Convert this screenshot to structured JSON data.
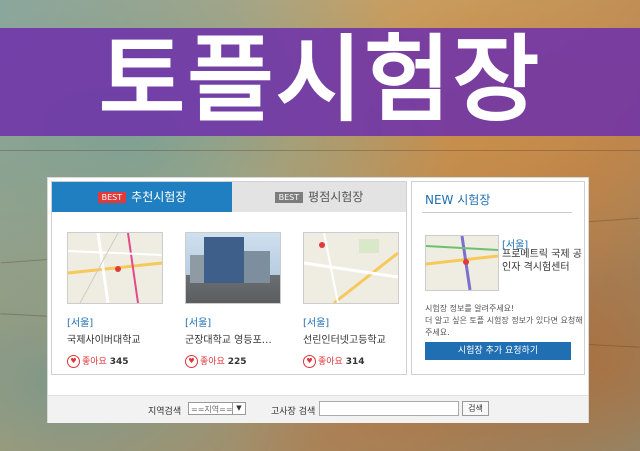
{
  "banner": {
    "title": "토플시험장"
  },
  "tabs": [
    {
      "badge": "BEST",
      "label": "추천시험장"
    },
    {
      "badge": "BEST",
      "label": "평점시험장"
    }
  ],
  "cards": [
    {
      "region": "[서울]",
      "name": "국제사이버대학교",
      "like_label": "좋아요",
      "like_count": "345"
    },
    {
      "region": "[서울]",
      "name": "군장대학교 영등포…",
      "like_label": "좋아요",
      "like_count": "225"
    },
    {
      "region": "[서울]",
      "name": "선린인터넷고등학교",
      "like_label": "좋아요",
      "like_count": "314"
    }
  ],
  "new_center": {
    "title": "NEW 시험장",
    "region": "[서울]",
    "name": "프로메트릭 국제 공인자 격시험센터",
    "desc_line1": "시험장 정보를 알려주세요!",
    "desc_line2": "더 알고 싶은 토플 시험장 정보가 있다면 요청해주세요.",
    "button": "시험장 추가 요청하기"
  },
  "search": {
    "region_label": "지역검색",
    "region_value": "==지역==",
    "center_label": "고사장 검색",
    "center_placeholder": "",
    "button": "검색"
  },
  "colors": {
    "banner": "#6e32aa",
    "accent": "#1f7fc0",
    "heart": "#e0343a"
  }
}
